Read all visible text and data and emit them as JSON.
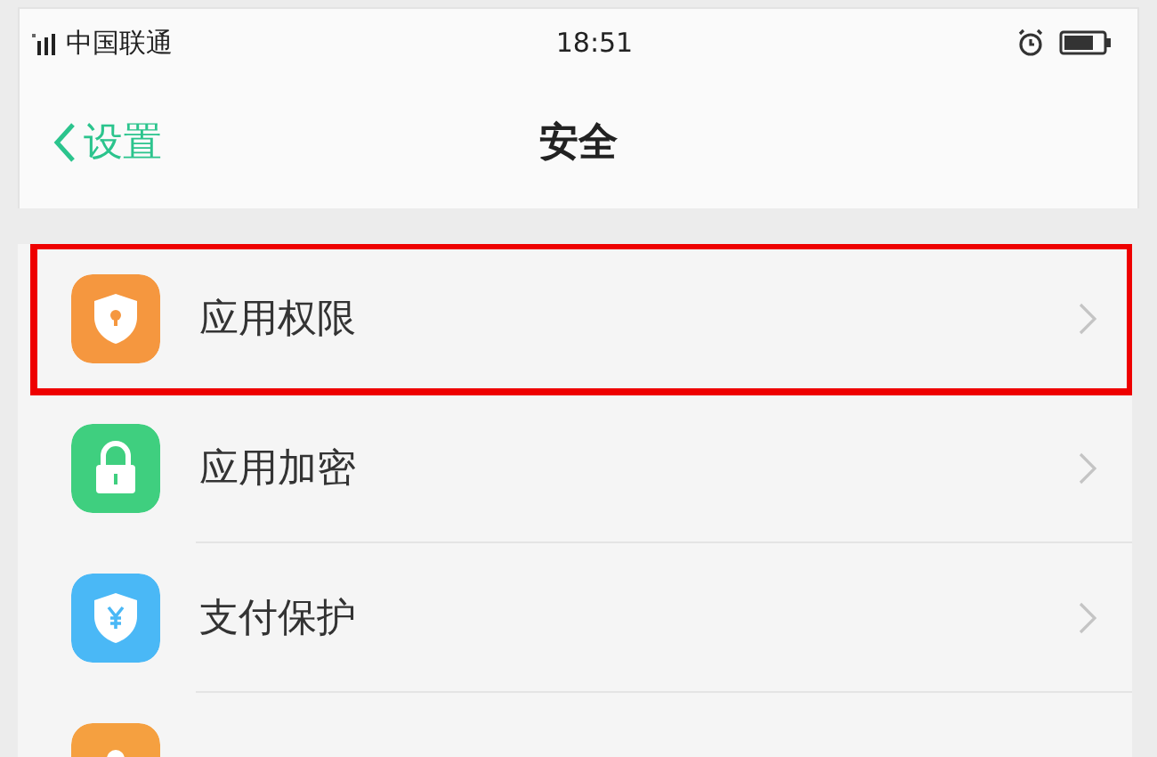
{
  "status_bar": {
    "carrier": "中国联通",
    "time": "18:51"
  },
  "nav": {
    "back": "设置",
    "title": "安全"
  },
  "items": [
    {
      "kind": "shield",
      "label": "应用权限",
      "color": "#f5973f",
      "highlighted": true
    },
    {
      "kind": "lock",
      "label": "应用加密",
      "color": "#3fcf7f",
      "highlighted": false
    },
    {
      "kind": "shield-yen",
      "label": "支付保护",
      "color": "#4ab8f6",
      "highlighted": false
    },
    {
      "kind": "partial",
      "color": "#f5a040",
      "highlighted": false
    }
  ]
}
